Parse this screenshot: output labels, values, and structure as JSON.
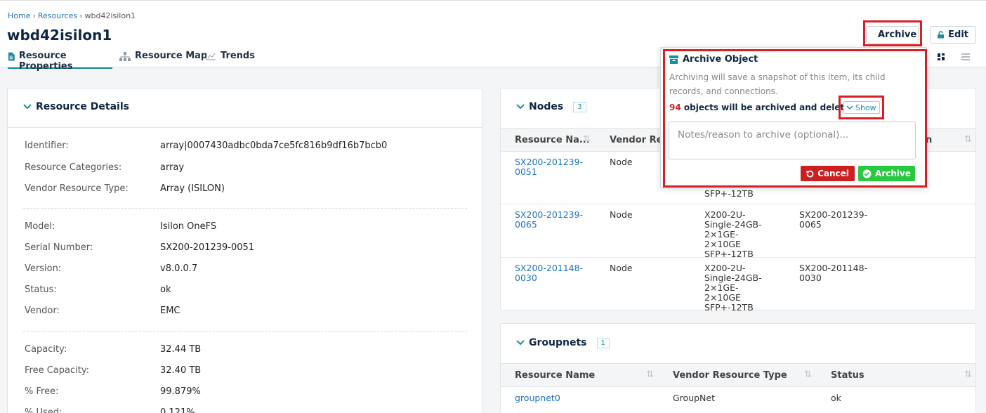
{
  "breadcrumb": {
    "home": "Home",
    "resources": "Resources",
    "current": "wbd42isilon1",
    "separator": "›"
  },
  "page_title": "wbd42isilon1",
  "tabs": [
    {
      "label": "Resource Properties",
      "icon": "document-icon",
      "active": true
    },
    {
      "label": "Resource Map",
      "icon": "sitemap-icon"
    },
    {
      "label": "Trends",
      "icon": "line-chart-icon"
    }
  ],
  "header_buttons": {
    "archive": "Archive",
    "edit": "Edit"
  },
  "details": {
    "title": "Resource Details",
    "group1": [
      {
        "k": "Identifier:",
        "v": "array|0007430adbc0bda7ce5fc816b9df16b7bcb0"
      },
      {
        "k": "Resource Categories:",
        "v": "array"
      },
      {
        "k": "Vendor Resource Type:",
        "v": "Array (ISILON)"
      }
    ],
    "group2": [
      {
        "k": "Model:",
        "v": "Isilon OneFS"
      },
      {
        "k": "Serial Number:",
        "v": "SX200-201239-0051"
      },
      {
        "k": "Version:",
        "v": "v8.0.0.7"
      },
      {
        "k": "Status:",
        "v": "ok"
      },
      {
        "k": "Vendor:",
        "v": "EMC"
      }
    ],
    "group3": [
      {
        "k": "Capacity:",
        "v": "32.44 TB"
      },
      {
        "k": "Free Capacity:",
        "v": "32.40 TB"
      },
      {
        "k": "% Free:",
        "v": "99.879%"
      },
      {
        "k": "% Used:",
        "v": "0.121%"
      }
    ]
  },
  "nodes": {
    "title": "Nodes",
    "count": "3",
    "columns": [
      "Resource Na...",
      "Vendor Res",
      "n"
    ],
    "rows": [
      {
        "name": "SX200-201239-0051",
        "type": "Node",
        "model": "SFP+-12TB",
        "serial": ""
      },
      {
        "name": "SX200-201239-0065",
        "type": "Node",
        "model": "X200-2U-Single-24GB-2×1GE-2×10GE SFP+-12TB",
        "serial": "SX200-201239-0065"
      },
      {
        "name": "SX200-201148-0030",
        "type": "Node",
        "model": "X200-2U-Single-24GB-2×1GE-2×10GE SFP+-12TB",
        "serial": "SX200-201148-0030"
      }
    ]
  },
  "groupnets": {
    "title": "Groupnets",
    "count": "1",
    "columns": [
      "Resource Name",
      "Vendor Resource Type",
      "Status"
    ],
    "rows": [
      {
        "name": "groupnet0",
        "type": "GroupNet",
        "status": "ok"
      }
    ]
  },
  "popover": {
    "title": "Archive Object",
    "description": "Archiving will save a snapshot of this item, its child records, and connections.",
    "count": "94",
    "count_text": " objects will be archived and deleted.",
    "show_label": "Show",
    "notes_placeholder": "Notes/reason to archive (optional)...",
    "cancel_label": "Cancel",
    "confirm_label": "Archive"
  },
  "colors": {
    "accent": "#1a8fa0",
    "highlight": "#d71f26",
    "link": "#1d72c2",
    "cancel": "#cc1f1f",
    "confirm": "#27c93f"
  }
}
